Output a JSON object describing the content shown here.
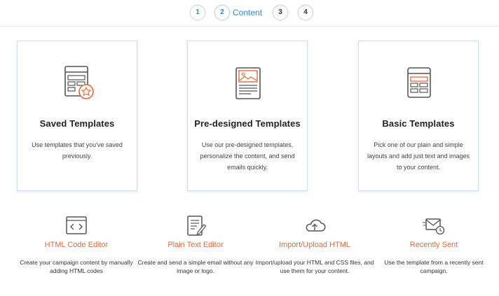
{
  "stepper": {
    "steps": [
      "1",
      "2",
      "3",
      "4"
    ],
    "active_label": "Content"
  },
  "cards": [
    {
      "title": "Saved Templates",
      "description": "Use templates that you've saved previously.",
      "icon": "saved-template-icon"
    },
    {
      "title": "Pre-designed Templates",
      "description": "Use our pre-designed templates, personalize the content, and send emails quickly.",
      "icon": "predesigned-template-icon"
    },
    {
      "title": "Basic Templates",
      "description": "Pick one of our plain and simple layouts and add just text and images to your content.",
      "icon": "basic-template-icon"
    }
  ],
  "options": [
    {
      "title": "HTML Code Editor",
      "description": "Create your campaign content by manually adding HTML codes",
      "icon": "code-editor-icon"
    },
    {
      "title": "Plain Text Editor",
      "description": "Create and send a simple email without any image or logo.",
      "icon": "plain-text-icon"
    },
    {
      "title": "Import/Upload HTML",
      "description": "Import/upload your HTML and CSS files, and use them for your content.",
      "icon": "cloud-upload-icon"
    },
    {
      "title": "Recently Sent",
      "description": "Use the template from a recently sent campaign.",
      "icon": "recently-sent-icon"
    }
  ],
  "colors": {
    "accent_orange": "#e8683a",
    "accent_blue": "#2e8bd0",
    "step_done_green": "#3aa05a",
    "card_border": "#cfe0f3"
  }
}
